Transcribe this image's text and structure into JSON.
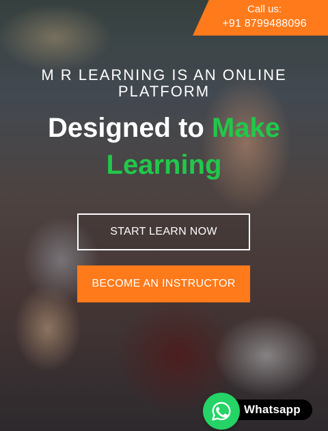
{
  "call_us": {
    "label": "Call us:",
    "phone": "+91 8799488096"
  },
  "hero": {
    "subheadline": "M R LEARNING IS AN ONLINE PLATFORM",
    "headline_part1": "Designed to ",
    "headline_accent": "Make",
    "headline_line2_accent": "Learning"
  },
  "buttons": {
    "start": "START LEARN NOW",
    "become": "BECOME AN INSTRUCTOR"
  },
  "whatsapp": {
    "label": "Whatsapp",
    "icon": "whatsapp-icon"
  },
  "colors": {
    "accent_orange": "#ff7a1a",
    "accent_green": "#21c84a",
    "whatsapp_green": "#25d366"
  }
}
